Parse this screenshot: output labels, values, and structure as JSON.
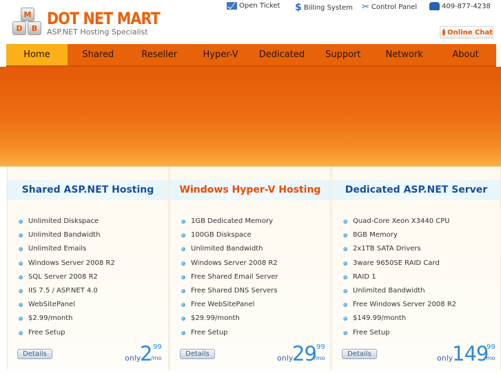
{
  "logo": {
    "cubes": [
      "M",
      "D",
      "B"
    ],
    "name": "DOT NET MART",
    "tagline": "ASP.NET Hosting Specialist"
  },
  "toplinks": {
    "open_ticket": "Open Ticket",
    "billing": "Billing System",
    "control_panel": "Control Panel",
    "phone": "409-877-4238"
  },
  "chat": {
    "label": "Online Chat"
  },
  "nav": {
    "items": [
      "Home",
      "Shared",
      "Reseller",
      "Hyper-V",
      "Dedicated",
      "Support",
      "Network",
      "About"
    ],
    "active": "Home"
  },
  "colors": {
    "brand_orange": "#ee5f08",
    "nav_active": "#fcb018",
    "title_blue": "#1a4e9c",
    "price_blue": "#2a8ad8"
  },
  "plans": [
    {
      "title": "Shared ASP.NET Hosting",
      "features": [
        "Unlimited Diskspace",
        "Unlimited Bandwidth",
        "Unlimited Emails",
        "Windows Server 2008 R2",
        "SQL Server 2008 R2",
        "IIS 7.5 / ASP.NET 4.0",
        "WebSitePanel",
        "$2.99/month",
        "Free Setup"
      ],
      "details": "Details",
      "price": {
        "only": "only",
        "dollars": "2",
        "cents": "99",
        "per": "/mo"
      }
    },
    {
      "title": "Windows Hyper-V Hosting",
      "features": [
        "1GB Dedicated Memory",
        "100GB Diskspace",
        "Unlimited Bandwidth",
        "Windows Server 2008 R2",
        "Free Shared Email Server",
        "Free Shared DNS Servers",
        "Free WebSitePanel",
        "$29.99/month",
        "Free Setup"
      ],
      "details": "Details",
      "price": {
        "only": "only",
        "dollars": "29",
        "cents": "99",
        "per": "/mo"
      }
    },
    {
      "title": "Dedicated ASP.NET Server",
      "features": [
        "Quad-Core Xeon X3440 CPU",
        "8GB Memory",
        "2x1TB SATA Drivers",
        "3ware 9650SE RAID Card",
        "RAID 1",
        "Unlimited Bandwidth",
        "Free Windows Server 2008 R2",
        "$149.99/month",
        "Free Setup"
      ],
      "details": "Details",
      "price": {
        "only": "only",
        "dollars": "149",
        "cents": "99",
        "per": "/mo"
      }
    }
  ]
}
